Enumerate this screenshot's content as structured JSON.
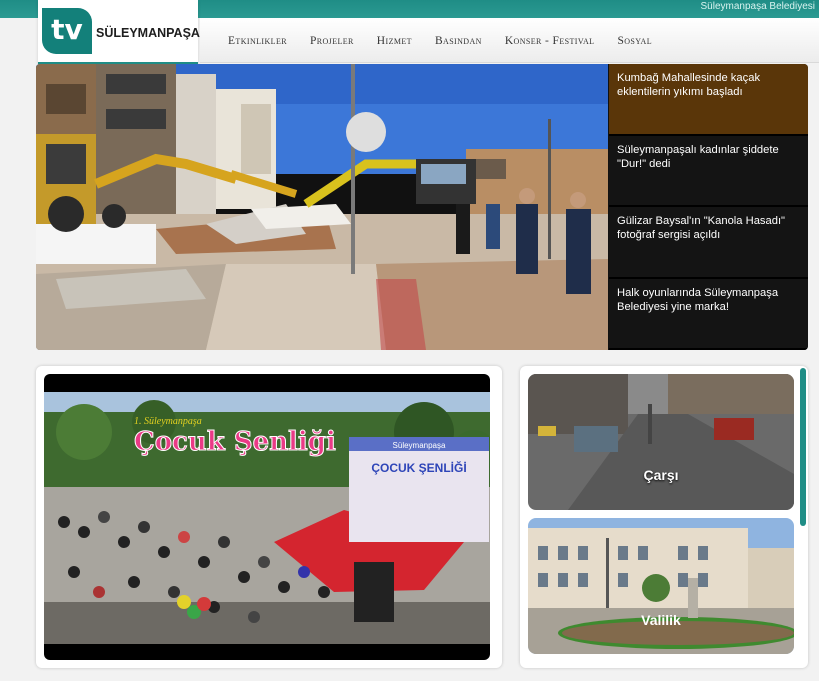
{
  "header": {
    "site_name": "Süleymanpaşa Belediyesi",
    "logo_mark": "tv",
    "logo_text": "SÜLEYMANPAŞA"
  },
  "nav": {
    "items": [
      "Etkinlikler",
      "Projeler",
      "Hizmet",
      "Basından",
      "Konser - Festival",
      "Sosyal"
    ]
  },
  "news": {
    "items": [
      "Kumbağ Mahallesinde kaçak eklentilerin yıkımı başladı",
      "Süleymanpaşalı kadınlar şiddete \"Dur!\" dedi",
      "Gülizar Baysal'ın \"Kanola Hasadı\" fotoğraf sergisi açıldı",
      "Halk oyunlarında Süleymanpaşa Belediyesi yine marka!"
    ]
  },
  "video": {
    "banner_title": "Çocuk Şenliği",
    "banner_sub": "1. Süleymanpaşa",
    "sign_top": "Süleymanpaşa",
    "sign_title": "ÇOCUK ŞENLİĞİ"
  },
  "cameras": {
    "items": [
      {
        "label": "Çarşı"
      },
      {
        "label": "Valilik"
      }
    ]
  },
  "colors": {
    "accent": "#1f8d86",
    "news_active": "#5a3609"
  }
}
